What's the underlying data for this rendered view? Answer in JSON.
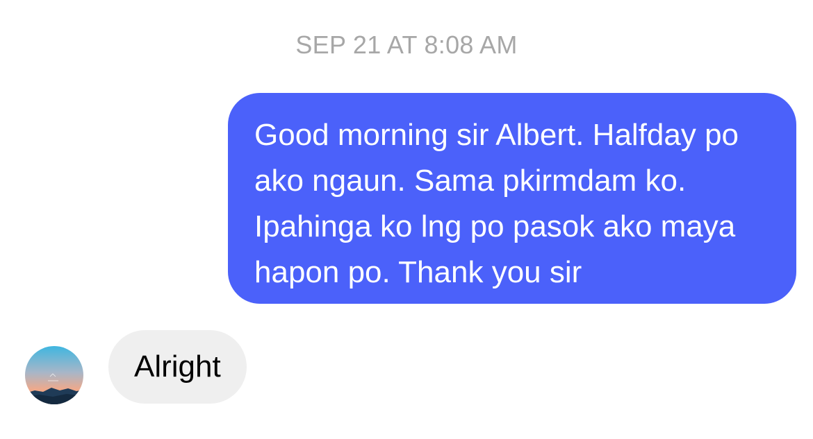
{
  "thread": {
    "timestamp": "SEP 21 AT 8:08 AM",
    "messages": [
      {
        "direction": "outgoing",
        "text": "Good morning sir Albert. Halfday po ako ngaun. Sama pkirmdam ko. Ipahinga ko lng po pasok ako maya hapon po. Thank you sir"
      },
      {
        "direction": "incoming",
        "text": "Alright",
        "avatar_icon": "sunset-avatar-icon"
      }
    ]
  },
  "colors": {
    "outgoing_bubble": "#4b61fa",
    "incoming_bubble": "#efefef",
    "timestamp_text": "#a7a7a7",
    "background": "#ffffff"
  }
}
